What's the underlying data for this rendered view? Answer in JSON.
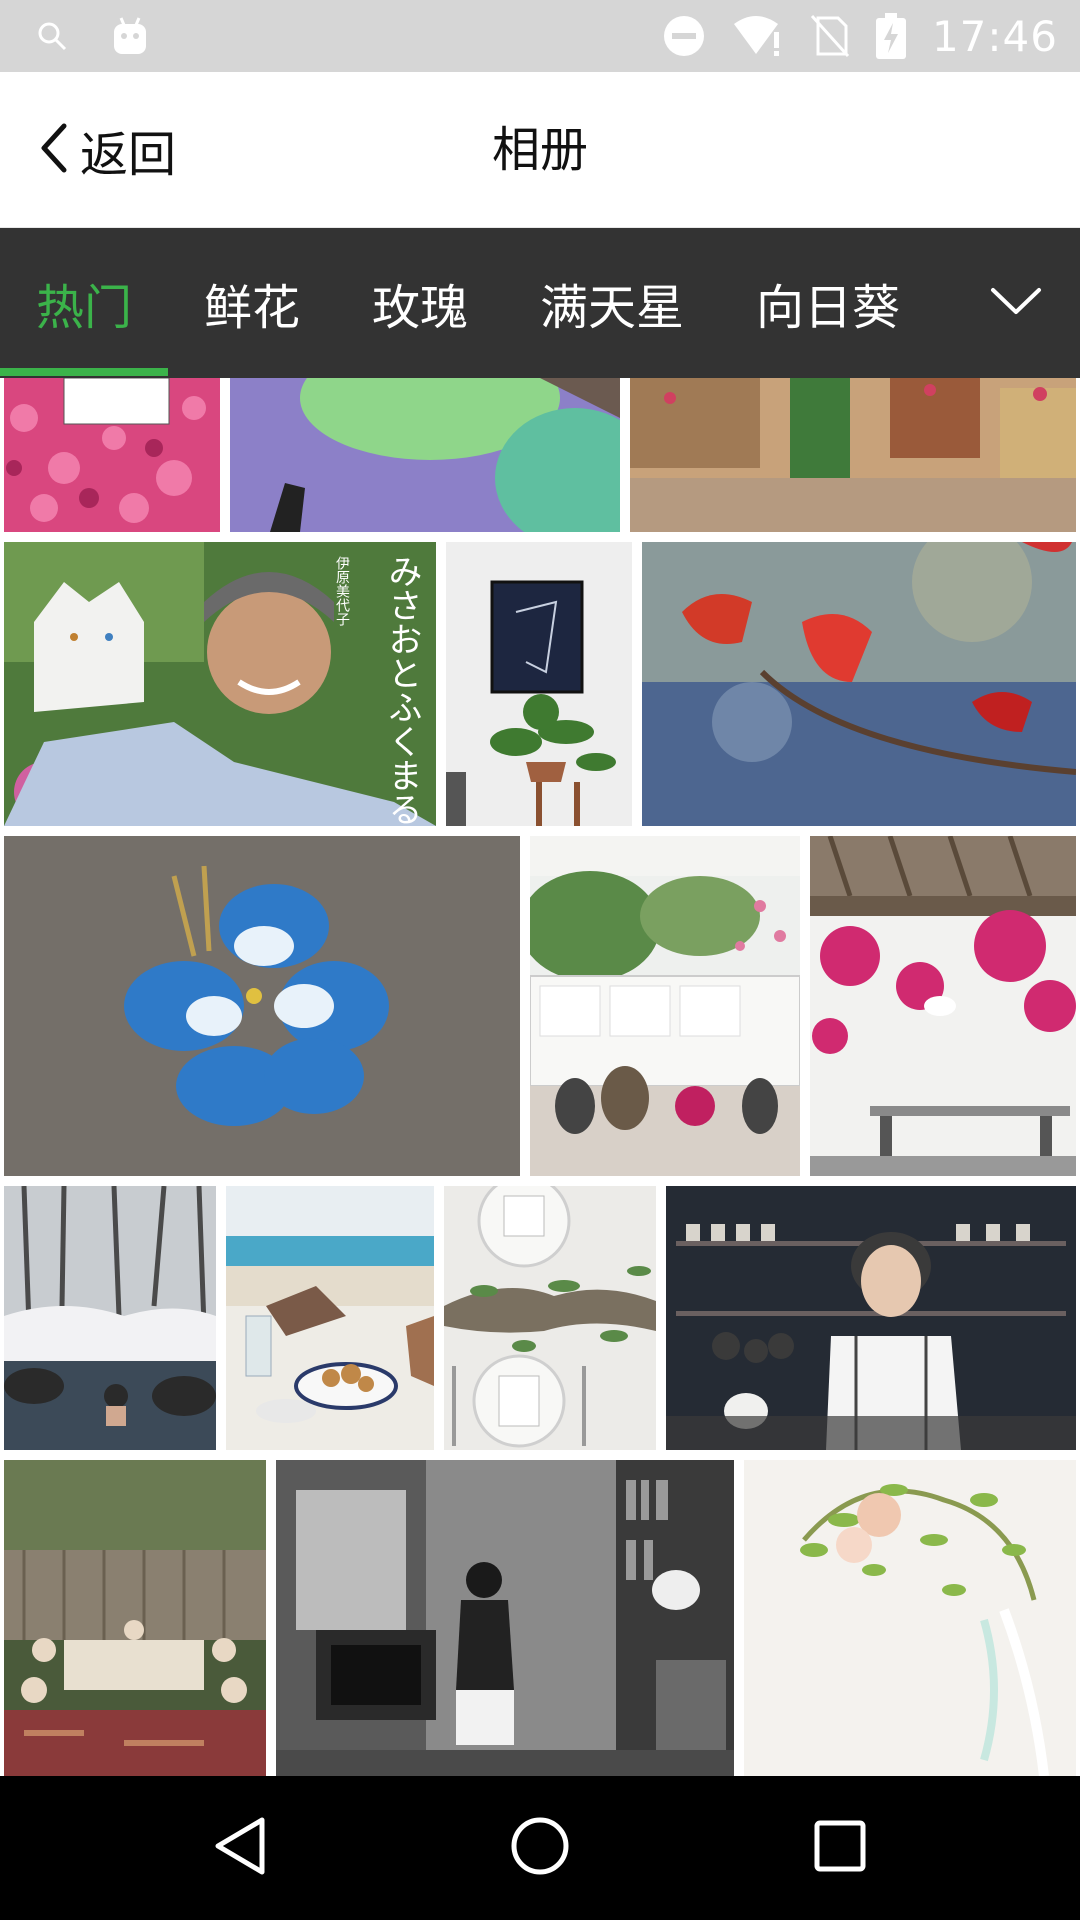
{
  "status_bar": {
    "time": "17:46",
    "icons": [
      "search-icon",
      "android-icon",
      "do-not-disturb-icon",
      "wifi-alert-icon",
      "no-sim-icon",
      "battery-charging-icon"
    ]
  },
  "header": {
    "back_label": "返回",
    "title": "相册"
  },
  "tabs": [
    {
      "label": "热门",
      "active": true
    },
    {
      "label": "鲜花",
      "active": false
    },
    {
      "label": "玫瑰",
      "active": false
    },
    {
      "label": "满天星",
      "active": false
    },
    {
      "label": "向日葵",
      "active": false
    }
  ],
  "tab_more_icon": "chevron-down-icon",
  "photo_overlay_text": {
    "book_cover_title": "みさおとふくまる",
    "book_cover_author": "伊原美代子"
  },
  "navigation": {
    "icons": [
      "back-triangle-icon",
      "home-circle-icon",
      "recents-square-icon"
    ]
  },
  "colors": {
    "accent": "#3bb34a",
    "tab_bar_bg": "#333333",
    "status_bar_bg": "#d6d6d6",
    "nav_bar_bg": "#000000"
  }
}
